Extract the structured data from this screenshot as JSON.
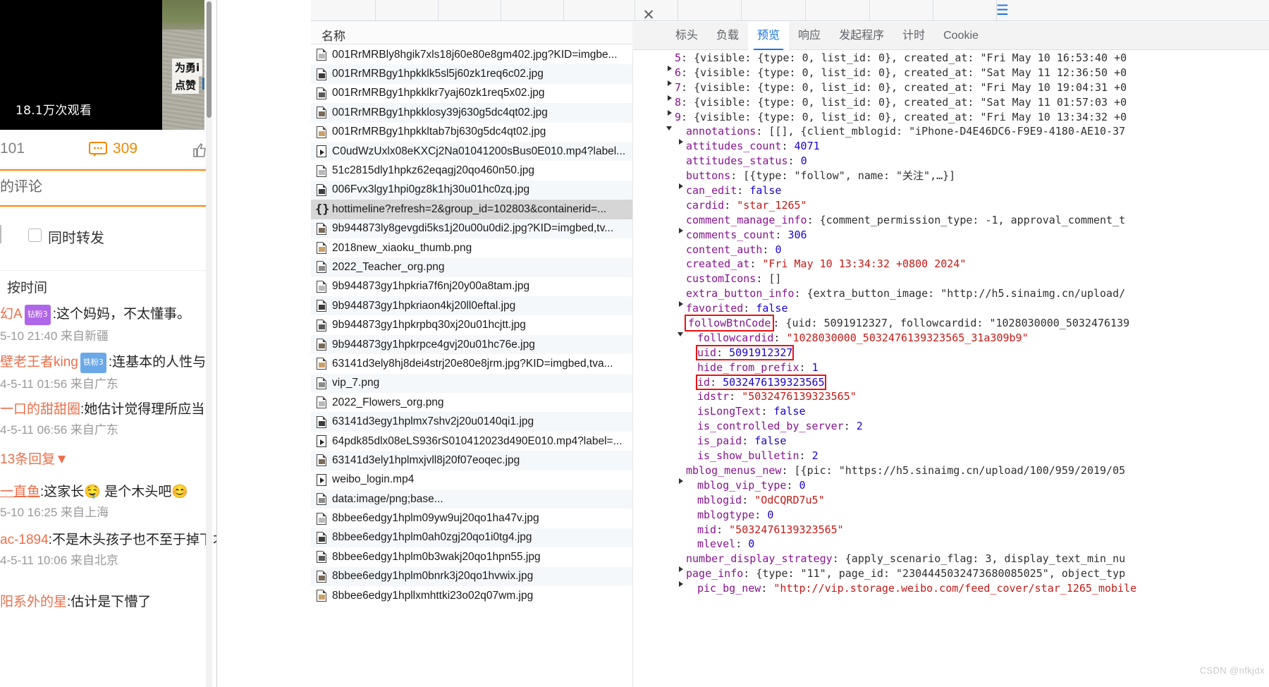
{
  "weibo": {
    "video": {
      "views_label": "18.1万次观看"
    },
    "photo": {
      "label_line1": "为勇i",
      "label_line2": "点赞"
    },
    "actions": {
      "repost_count": "101",
      "comment_icon": "comment-bubble-icon",
      "comment_count": "309",
      "like_icon": "thumb-up-icon"
    },
    "tab_label": "的评论",
    "repost": {
      "checkbox_label": "同时转发",
      "checked": false
    },
    "sort_label": "按时间",
    "comments": [
      {
        "user": "幻A",
        "badge": "钻粉3",
        "badge_type": "diamond",
        "text": ":这个妈妈，不太懂事。",
        "meta": "5-10 21:40 来自新疆"
      },
      {
        "user": "壁老王者king",
        "badge": "铁粉3",
        "badge_type": "iron",
        "text": ":连基本的人性与",
        "meta": "4-5-11 01:56 来自广东"
      },
      {
        "user": "一口的甜甜圈",
        "badge": "",
        "badge_type": "",
        "text": ":她估计觉得理所应当",
        "meta": "4-5-11 06:56 来自广东"
      },
      {
        "user": "",
        "badge": "",
        "badge_type": "",
        "text": "13条回复▼",
        "meta": "",
        "is_replies": true
      },
      {
        "user": "一直鱼",
        "badge": "",
        "badge_type": "",
        "text": ":这家长🤤 是个木头吧😊",
        "meta": "5-10 16:25 来自上海"
      },
      {
        "user": "ac-1894",
        "badge": "",
        "badge_type": "",
        "text": ":不是木头孩子也不至于掉下才",
        "meta": "4-5-11 10:06 来自北京"
      },
      {
        "user": "阳系外的星",
        "badge": "",
        "badge_type": "",
        "text": ":估计是下懵了",
        "meta": ""
      }
    ]
  },
  "network_list": {
    "column_header": "名称",
    "rows": [
      {
        "name": "001RrMRBly8hgik7xls18j60e80e8gm402.jpg?KID=imgbe...",
        "icon": "image-file-icon"
      },
      {
        "name": "001RrMRBgy1hpkklk5sl5j60zk1req6c02.jpg",
        "icon": "image-file-icon"
      },
      {
        "name": "001RrMRBgy1hpkklkr7yaj60zk1req5x02.jpg",
        "icon": "image-file-icon"
      },
      {
        "name": "001RrMRBgy1hpkklosy39j630g5dc4qt02.jpg",
        "icon": "image-file-icon"
      },
      {
        "name": "001RrMRBgy1hpkkltab7bj630g5dc4qt02.jpg",
        "icon": "image-file-icon"
      },
      {
        "name": "C0udWzUxlx08eKXCj2Na01041200sBus0E010.mp4?label...",
        "icon": "video-file-icon"
      },
      {
        "name": "51c2815dly1hpkz62eqagj20qo460n50.jpg",
        "icon": "image-file-icon"
      },
      {
        "name": "006Fvx3lgy1hpi0gz8k1hj30u01hc0zq.jpg",
        "icon": "image-file-icon"
      },
      {
        "name": "hottimeline?refresh=2&group_id=102803&containerid=...",
        "icon": "json-file-icon",
        "selected": true
      },
      {
        "name": "9b944873ly8gevgdi5ks1j20u00u0di2.jpg?KID=imgbed,tv...",
        "icon": "image-file-icon"
      },
      {
        "name": "2018new_xiaoku_thumb.png",
        "icon": "image-file-icon"
      },
      {
        "name": "2022_Teacher_org.png",
        "icon": "image-file-icon"
      },
      {
        "name": "9b944873gy1hpkria7f6nj20y00a8tam.jpg",
        "icon": "image-file-icon"
      },
      {
        "name": "9b944873gy1hpkriaon4kj20ll0eftal.jpg",
        "icon": "image-file-icon"
      },
      {
        "name": "9b944873gy1hpkrpbq30xj20u01hcjtt.jpg",
        "icon": "image-file-icon"
      },
      {
        "name": "9b944873gy1hpkrpce4gvj20u01hc76e.jpg",
        "icon": "image-file-icon"
      },
      {
        "name": "63141d3ely8hj8dei4strj20e80e8jrm.jpg?KID=imgbed,tva...",
        "icon": "image-file-icon"
      },
      {
        "name": "vip_7.png",
        "icon": "image-file-icon"
      },
      {
        "name": "2022_Flowers_org.png",
        "icon": "image-file-icon"
      },
      {
        "name": "63141d3egy1hplmx7shv2j20u0140qi1.jpg",
        "icon": "image-file-icon"
      },
      {
        "name": "64pdk85dlx08eLS936rS010412023d490E010.mp4?label=...",
        "icon": "video-file-icon"
      },
      {
        "name": "63141d3ely1hplmxjvll8j20f07eoqec.jpg",
        "icon": "image-file-icon"
      },
      {
        "name": "weibo_login.mp4",
        "icon": "video-file-icon"
      },
      {
        "name": "data:image/png;base...",
        "icon": "image-file-icon"
      },
      {
        "name": "8bbee6edgy1hplm09yw9uj20qo1ha47v.jpg",
        "icon": "image-file-icon"
      },
      {
        "name": "8bbee6edgy1hplm0ah0zgj20qo1i0tg4.jpg",
        "icon": "image-file-icon"
      },
      {
        "name": "8bbee6edgy1hplm0b3wakj20qo1hpn55.jpg",
        "icon": "image-file-icon"
      },
      {
        "name": "8bbee6edgy1hplm0bnrk3j20qo1hvwix.jpg",
        "icon": "image-file-icon"
      },
      {
        "name": "8bbee6edgy1hpllxmhttki23o02q07wm.jpg",
        "icon": "image-file-icon"
      }
    ]
  },
  "devtools": {
    "close_icon": "close-icon",
    "tabs": [
      {
        "label": "标头",
        "active": false
      },
      {
        "label": "负载",
        "active": false
      },
      {
        "label": "预览",
        "active": true
      },
      {
        "label": "响应",
        "active": false
      },
      {
        "label": "发起程序",
        "active": false
      },
      {
        "label": "计时",
        "active": false
      },
      {
        "label": "Cookie",
        "active": false
      }
    ],
    "accent_color": "#1a73e8",
    "highlight_color": "#ee1111",
    "json_lines": [
      {
        "indent": 2,
        "twisty": "right",
        "key": "5",
        "key_kind": "index",
        "rest": ": {visible: {type: 0, list_id: 0}, created_at: \"Fri May 10 16:53:40 +0"
      },
      {
        "indent": 2,
        "twisty": "right",
        "key": "6",
        "key_kind": "index",
        "rest": ": {visible: {type: 0, list_id: 0}, created_at: \"Sat May 11 12:36:50 +0"
      },
      {
        "indent": 2,
        "twisty": "right",
        "key": "7",
        "key_kind": "index",
        "rest": ": {visible: {type: 0, list_id: 0}, created_at: \"Fri May 10 19:04:31 +0"
      },
      {
        "indent": 2,
        "twisty": "right",
        "key": "8",
        "key_kind": "index",
        "rest": ": {visible: {type: 0, list_id: 0}, created_at: \"Sat May 11 01:57:03 +0"
      },
      {
        "indent": 2,
        "twisty": "down",
        "key": "9",
        "key_kind": "index",
        "rest": ": {visible: {type: 0, list_id: 0}, created_at: \"Fri May 10 13:34:32 +0"
      },
      {
        "indent": 3,
        "twisty": "right",
        "key": "annotations",
        "key_kind": "key",
        "rest": ": [[], {client_mblogid: \"iPhone-D4E46DC6-F9E9-4180-AE10-37"
      },
      {
        "indent": 3,
        "twisty": "none",
        "key": "attitudes_count",
        "key_kind": "key",
        "rest": ": ",
        "value": "4071",
        "value_kind": "num"
      },
      {
        "indent": 3,
        "twisty": "none",
        "key": "attitudes_status",
        "key_kind": "key",
        "rest": ": ",
        "value": "0",
        "value_kind": "num"
      },
      {
        "indent": 3,
        "twisty": "right",
        "key": "buttons",
        "key_kind": "key",
        "rest": ": [{type: \"follow\", name: \"关注\",…}]"
      },
      {
        "indent": 3,
        "twisty": "none",
        "key": "can_edit",
        "key_kind": "key",
        "rest": ": ",
        "value": "false",
        "value_kind": "bool"
      },
      {
        "indent": 3,
        "twisty": "none",
        "key": "cardid",
        "key_kind": "key",
        "rest": ": ",
        "value": "\"star_1265\"",
        "value_kind": "str"
      },
      {
        "indent": 3,
        "twisty": "right",
        "key": "comment_manage_info",
        "key_kind": "key",
        "rest": ": {comment_permission_type: -1, approval_comment_t"
      },
      {
        "indent": 3,
        "twisty": "none",
        "key": "comments_count",
        "key_kind": "key",
        "rest": ": ",
        "value": "306",
        "value_kind": "num"
      },
      {
        "indent": 3,
        "twisty": "none",
        "key": "content_auth",
        "key_kind": "key",
        "rest": ": ",
        "value": "0",
        "value_kind": "num"
      },
      {
        "indent": 3,
        "twisty": "none",
        "key": "created_at",
        "key_kind": "key",
        "rest": ": ",
        "value": "\"Fri May 10 13:34:32 +0800 2024\"",
        "value_kind": "str"
      },
      {
        "indent": 3,
        "twisty": "none",
        "key": "customIcons",
        "key_kind": "key",
        "rest": ": []"
      },
      {
        "indent": 3,
        "twisty": "right",
        "key": "extra_button_info",
        "key_kind": "key",
        "rest": ": {extra_button_image: \"http://h5.sinaimg.cn/upload/"
      },
      {
        "indent": 3,
        "twisty": "none",
        "key": "favorited",
        "key_kind": "key",
        "rest": ": ",
        "value": "false",
        "value_kind": "bool"
      },
      {
        "indent": 3,
        "twisty": "down",
        "key": "followBtnCode",
        "key_kind": "key",
        "rest": ": {uid: 5091912327, followcardid: \"1028030000_5032476139",
        "highlight_key": true
      },
      {
        "indent": 4,
        "twisty": "none",
        "key": "followcardid",
        "key_kind": "key",
        "rest": ": ",
        "value": "\"1028030000_5032476139323565_31a309b9\"",
        "value_kind": "str"
      },
      {
        "indent": 4,
        "twisty": "none",
        "key": "uid",
        "key_kind": "key",
        "rest": ": ",
        "value": "5091912327",
        "value_kind": "num",
        "highlight_line": true
      },
      {
        "indent": 4,
        "twisty": "none",
        "key": "hide_from_prefix",
        "key_kind": "key",
        "rest": ": ",
        "value": "1",
        "value_kind": "num"
      },
      {
        "indent": 4,
        "twisty": "none",
        "key": "id",
        "key_kind": "key",
        "rest": ": ",
        "value": "5032476139323565",
        "value_kind": "num",
        "highlight_line": true
      },
      {
        "indent": 4,
        "twisty": "none",
        "key": "idstr",
        "key_kind": "key",
        "rest": ": ",
        "value": "\"5032476139323565\"",
        "value_kind": "str"
      },
      {
        "indent": 4,
        "twisty": "none",
        "key": "isLongText",
        "key_kind": "key",
        "rest": ": ",
        "value": "false",
        "value_kind": "bool"
      },
      {
        "indent": 4,
        "twisty": "none",
        "key": "is_controlled_by_server",
        "key_kind": "key",
        "rest": ": ",
        "value": "2",
        "value_kind": "num"
      },
      {
        "indent": 4,
        "twisty": "none",
        "key": "is_paid",
        "key_kind": "key",
        "rest": ": ",
        "value": "false",
        "value_kind": "bool"
      },
      {
        "indent": 4,
        "twisty": "none",
        "key": "is_show_bulletin",
        "key_kind": "key",
        "rest": ": ",
        "value": "2",
        "value_kind": "num"
      },
      {
        "indent": 3,
        "twisty": "right",
        "key": "mblog_menus_new",
        "key_kind": "key",
        "rest": ": [{pic: \"https://h5.sinaimg.cn/upload/100/959/2019/05"
      },
      {
        "indent": 4,
        "twisty": "none",
        "key": "mblog_vip_type",
        "key_kind": "key",
        "rest": ": ",
        "value": "0",
        "value_kind": "num"
      },
      {
        "indent": 4,
        "twisty": "none",
        "key": "mblogid",
        "key_kind": "key",
        "rest": ": ",
        "value": "\"OdCQRD7u5\"",
        "value_kind": "str"
      },
      {
        "indent": 4,
        "twisty": "none",
        "key": "mblogtype",
        "key_kind": "key",
        "rest": ": ",
        "value": "0",
        "value_kind": "num"
      },
      {
        "indent": 4,
        "twisty": "none",
        "key": "mid",
        "key_kind": "key",
        "rest": ": ",
        "value": "\"5032476139323565\"",
        "value_kind": "str"
      },
      {
        "indent": 4,
        "twisty": "none",
        "key": "mlevel",
        "key_kind": "key",
        "rest": ": ",
        "value": "0",
        "value_kind": "num"
      },
      {
        "indent": 3,
        "twisty": "right",
        "key": "number_display_strategy",
        "key_kind": "key",
        "rest": ": {apply_scenario_flag: 3, display_text_min_nu"
      },
      {
        "indent": 3,
        "twisty": "right",
        "key": "page_info",
        "key_kind": "key",
        "rest": ": {type: \"11\", page_id: \"2304445032473680085025\", object_typ"
      },
      {
        "indent": 4,
        "twisty": "none",
        "key": "pic_bg_new",
        "key_kind": "key",
        "rest": ": ",
        "value": "\"http://vip.storage.weibo.com/feed_cover/star_1265_mobile",
        "value_kind": "str"
      }
    ]
  },
  "watermark": "CSDN @nfkjdx"
}
